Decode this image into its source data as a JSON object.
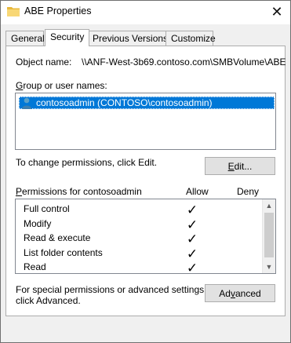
{
  "window": {
    "title": "ABE Properties",
    "close_glyph": "✕"
  },
  "tabs": [
    {
      "label": "General",
      "active": false
    },
    {
      "label": "Security",
      "active": true
    },
    {
      "label": "Previous Versions",
      "active": false
    },
    {
      "label": "Customize",
      "active": false
    }
  ],
  "object": {
    "label": "Object name:",
    "value": "\\\\ANF-West-3b69.contoso.com\\SMBVolume\\ABE"
  },
  "group": {
    "label": "Group or user names:",
    "users": [
      {
        "name": "contosoadmin (CONTOSO\\contosoadmin)",
        "selected": true,
        "icon": "user-icon"
      }
    ]
  },
  "change_hint": "To change permissions, click Edit.",
  "edit_button": {
    "label_u": "E",
    "label_rest": "dit..."
  },
  "permissions": {
    "label": "Permissions for contosoadmin",
    "col_allow": "Allow",
    "col_deny": "Deny",
    "rows": [
      {
        "name": "Full control",
        "allow": "✓",
        "deny": ""
      },
      {
        "name": "Modify",
        "allow": "✓",
        "deny": ""
      },
      {
        "name": "Read & execute",
        "allow": "✓",
        "deny": ""
      },
      {
        "name": "List folder contents",
        "allow": "✓",
        "deny": ""
      },
      {
        "name": "Read",
        "allow": "✓",
        "deny": ""
      }
    ]
  },
  "advanced_hint": {
    "line1": "For special permissions or advanced settings,",
    "line2": "click Advanced."
  },
  "advanced_button": {
    "label_pre": "Ad",
    "label_u": "v",
    "label_rest": "anced"
  },
  "colors": {
    "selection": "#0078d7",
    "window_bg": "#f0f0f0",
    "panel_bg": "#ffffff"
  }
}
